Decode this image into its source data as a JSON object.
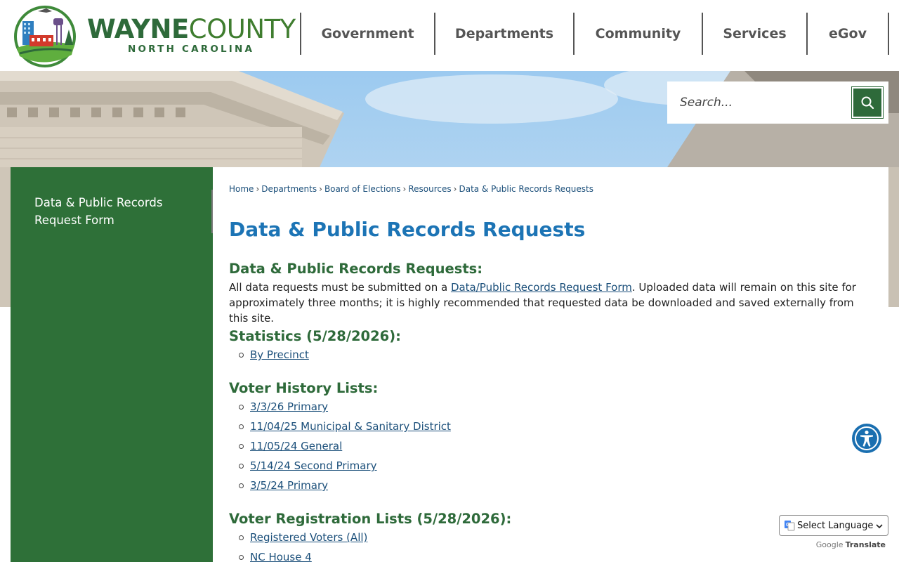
{
  "header": {
    "logo_name_part1": "WAYNE",
    "logo_name_part2": "COUNTY",
    "logo_state": "NORTH CAROLINA"
  },
  "nav": [
    {
      "label": "Government"
    },
    {
      "label": "Departments"
    },
    {
      "label": "Community"
    },
    {
      "label": "Services"
    },
    {
      "label": "eGov"
    }
  ],
  "search": {
    "placeholder": "Search..."
  },
  "sidebar": {
    "items": [
      {
        "label": "Data & Public Records Request Form"
      }
    ]
  },
  "breadcrumb": [
    "Home",
    "Departments",
    "Board of Elections",
    "Resources",
    "Data & Public Records Requests"
  ],
  "page": {
    "title": "Data & Public Records Requests",
    "section1_heading": "Data & Public Records Requests:",
    "section1_text_before": "All data requests must be submitted on a ",
    "section1_link": "Data/Public Records Request Form",
    "section1_text_after": ". Uploaded data will remain on this site for approximately three months; it is highly recommended that requested data be downloaded and saved externally from this site.",
    "statistics_heading": "Statistics (5/28/2026):",
    "statistics_links": [
      "By Precinct"
    ],
    "history_heading": "Voter History Lists:",
    "history_links": [
      "3/3/26 Primary",
      "11/04/25 Municipal & Sanitary District",
      "11/05/24 General",
      "5/14/24 Second Primary",
      "3/5/24 Primary"
    ],
    "registration_heading": "Voter Registration Lists (5/28/2026):",
    "registration_links": [
      "Registered Voters (All)",
      "NC House 4"
    ]
  },
  "translate": {
    "select_label": "Select Language",
    "powered_by": "Google",
    "translate_word": "Translate"
  },
  "colors": {
    "brand_green": "#2e6a3a",
    "title_blue": "#1c74b5",
    "link_blue": "#1b4f7a",
    "accessibility_blue": "#1a6fb0"
  }
}
